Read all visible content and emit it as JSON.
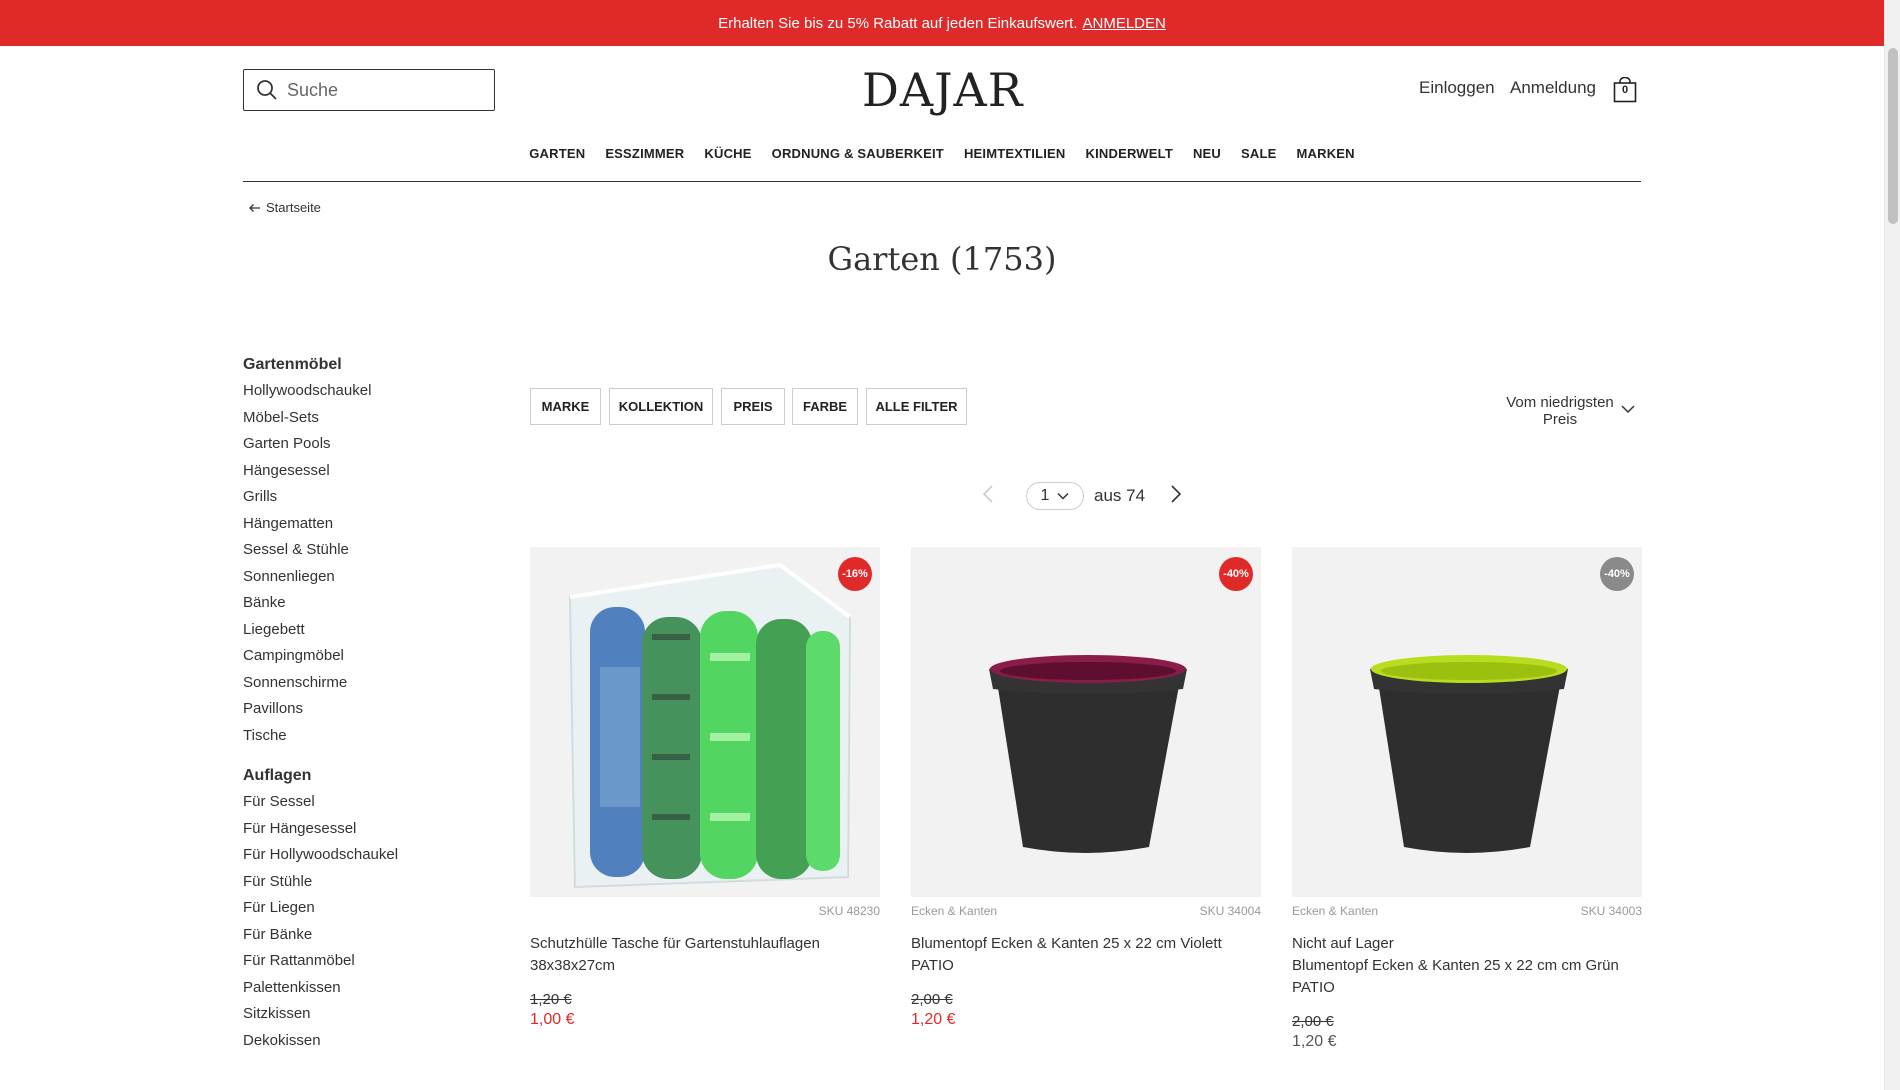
{
  "promo": {
    "text": "Erhalten Sie bis zu 5% Rabatt auf jeden Einkaufswert.",
    "link": "ANMELDEN"
  },
  "header": {
    "search_placeholder": "Suche",
    "logo": "DAJAR",
    "login": "Einloggen",
    "register": "Anmeldung",
    "cart_count": "0"
  },
  "nav": [
    "GARTEN",
    "ESSZIMMER",
    "KÜCHE",
    "ORDNUNG & SAUBERKEIT",
    "HEIMTEXTILIEN",
    "KINDERWELT",
    "NEU",
    "SALE",
    "MARKEN"
  ],
  "breadcrumb": "Startseite",
  "page_title": "Garten (1753)",
  "sidebar": {
    "group1_title": "Gartenmöbel",
    "group1": [
      "Hollywoodschaukel",
      "Möbel-Sets",
      "Garten Pools",
      "Hängesessel",
      "Grills",
      "Hängematten",
      "Sessel & Stühle",
      "Sonnenliegen",
      "Bänke",
      "Liegebett",
      "Campingmöbel",
      "Sonnenschirme",
      "Pavillons",
      "Tische"
    ],
    "group2_title": "Auflagen",
    "group2": [
      "Für Sessel",
      "Für Hängesessel",
      "Für Hollywoodschaukel",
      "Für Stühle",
      "Für Liegen",
      "Für Bänke",
      "Für Rattanmöbel",
      "Palettenkissen",
      "Sitzkissen",
      "Dekokissen"
    ]
  },
  "filters": [
    "MARKE",
    "KOLLEKTION",
    "PREIS",
    "FARBE",
    "ALLE FILTER"
  ],
  "sort": {
    "line1": "Vom niedrigsten",
    "line2": "Preis"
  },
  "pagination": {
    "current": "1",
    "of_text": "aus 74"
  },
  "products": [
    {
      "badge": "-16%",
      "brand": "",
      "sku": "SKU 48230",
      "stock": "",
      "name": "Schutzhülle Tasche für Gartenstuhlauflagen 38x38x27cm",
      "old_price": "1,20 €",
      "price": "1,00 €"
    },
    {
      "badge": "-40%",
      "brand": "Ecken & Kanten",
      "sku": "SKU 34004",
      "stock": "",
      "name": "Blumentopf Ecken & Kanten 25 x 22 cm Violett PATIO",
      "old_price": "2,00 €",
      "price": "1,20 €"
    },
    {
      "badge": "-40%",
      "brand": "Ecken & Kanten",
      "sku": "SKU 34003",
      "stock": "Nicht auf Lager",
      "name": "Blumentopf Ecken & Kanten 25 x 22 cm cm Grün PATIO",
      "old_price": "2,00 €",
      "price": "1,20 €"
    }
  ],
  "colors": {
    "accent_red": "#e02a2a",
    "badge_grey": "#8a8a8a",
    "pot_rim_violet": "#8a1c4a",
    "pot_rim_green": "#b8dc1e"
  },
  "icons": [
    "search-icon",
    "shopping-bag-icon",
    "arrow-left-icon",
    "chevron-down-icon",
    "chevron-left-icon",
    "chevron-right-icon"
  ]
}
